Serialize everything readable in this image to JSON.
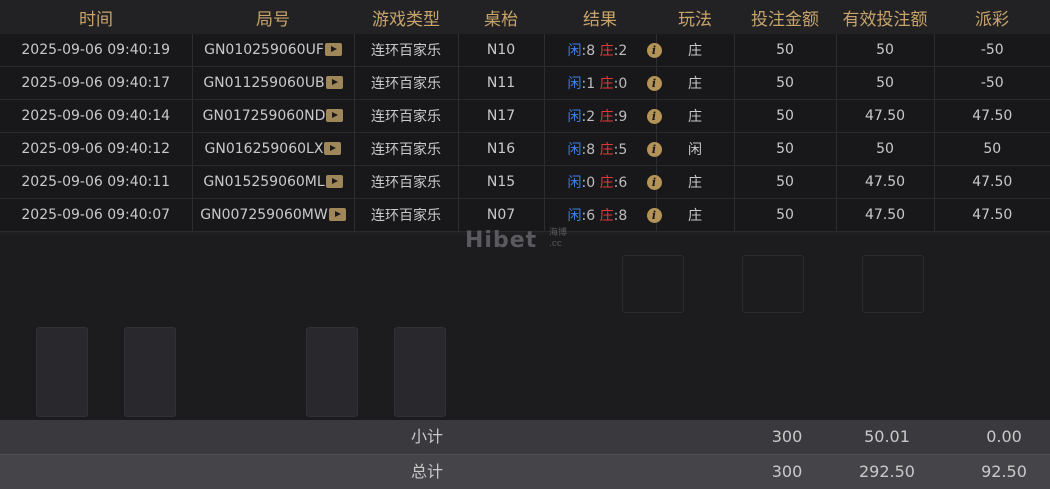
{
  "columns": [
    "时间",
    "局号",
    "游戏类型",
    "桌枱",
    "结果",
    "玩法",
    "投注金额",
    "有效投注额",
    "派彩"
  ],
  "labels": {
    "player": "闲",
    "banker": "庄"
  },
  "rows": [
    {
      "time": "2025-09-06 09:40:19",
      "round": "GN010259060UF",
      "game": "连环百家乐",
      "table": "N10",
      "player_score": "8",
      "banker_score": "2",
      "play": "庄",
      "bet": "50",
      "valid": "50",
      "payout": "-50"
    },
    {
      "time": "2025-09-06 09:40:17",
      "round": "GN011259060UB",
      "game": "连环百家乐",
      "table": "N11",
      "player_score": "1",
      "banker_score": "0",
      "play": "庄",
      "bet": "50",
      "valid": "50",
      "payout": "-50"
    },
    {
      "time": "2025-09-06 09:40:14",
      "round": "GN017259060ND",
      "game": "连环百家乐",
      "table": "N17",
      "player_score": "2",
      "banker_score": "9",
      "play": "庄",
      "bet": "50",
      "valid": "47.50",
      "payout": "47.50"
    },
    {
      "time": "2025-09-06 09:40:12",
      "round": "GN016259060LX",
      "game": "连环百家乐",
      "table": "N16",
      "player_score": "8",
      "banker_score": "5",
      "play": "闲",
      "bet": "50",
      "valid": "50",
      "payout": "50"
    },
    {
      "time": "2025-09-06 09:40:11",
      "round": "GN015259060ML",
      "game": "连环百家乐",
      "table": "N15",
      "player_score": "0",
      "banker_score": "6",
      "play": "庄",
      "bet": "50",
      "valid": "47.50",
      "payout": "47.50"
    },
    {
      "time": "2025-09-06 09:40:07",
      "round": "GN007259060MW",
      "game": "连环百家乐",
      "table": "N07",
      "player_score": "6",
      "banker_score": "8",
      "play": "庄",
      "bet": "50",
      "valid": "47.50",
      "payout": "47.50"
    }
  ],
  "subtotal": {
    "label": "小计",
    "bet": "300",
    "valid": "50.01",
    "payout": "0.00"
  },
  "total": {
    "label": "总计",
    "bet": "300",
    "valid": "292.50",
    "payout": "92.50"
  },
  "watermark": {
    "text": "Hibet",
    "sub": "海博",
    "domain": ".cc"
  },
  "colors": {
    "header_text": "#c8a46b",
    "player": "#3d7fe6",
    "banker": "#e33838",
    "loss": "#3e9d3e",
    "win": "#e23030"
  }
}
